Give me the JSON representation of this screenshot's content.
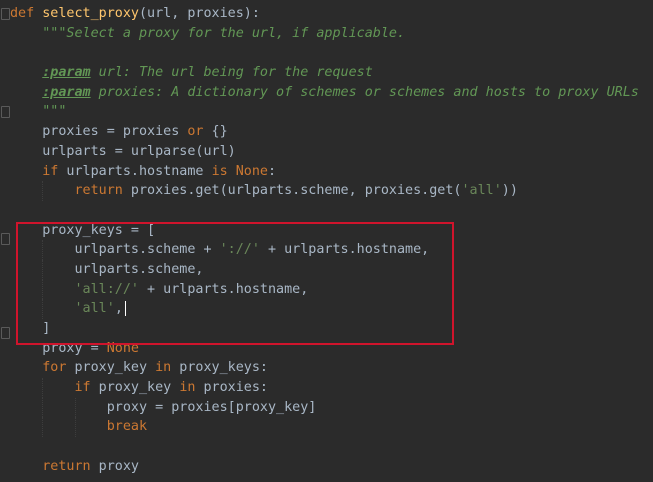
{
  "code": {
    "lines": [
      [
        {
          "t": "def ",
          "c": "kw"
        },
        {
          "t": "select_proxy",
          "c": "fn"
        },
        {
          "t": "(url, proxies):",
          "c": ""
        }
      ],
      [
        {
          "t": "    \"\"\"Select a proxy for the url, if applicable.",
          "c": "doc"
        }
      ],
      [
        {
          "t": "",
          "c": ""
        }
      ],
      [
        {
          "t": "    ",
          "c": ""
        },
        {
          "t": ":param",
          "c": "tag"
        },
        {
          "t": " url: The url being for the request",
          "c": "doc"
        }
      ],
      [
        {
          "t": "    ",
          "c": ""
        },
        {
          "t": ":param",
          "c": "tag"
        },
        {
          "t": " proxies: A dictionary of schemes or schemes and hosts to proxy URLs",
          "c": "doc"
        }
      ],
      [
        {
          "t": "    \"\"\"",
          "c": "doc"
        }
      ],
      [
        {
          "t": "    proxies = proxies ",
          "c": ""
        },
        {
          "t": "or",
          "c": "kw"
        },
        {
          "t": " {}",
          "c": ""
        }
      ],
      [
        {
          "t": "    urlparts = urlparse(url)",
          "c": ""
        }
      ],
      [
        {
          "t": "    ",
          "c": ""
        },
        {
          "t": "if",
          "c": "kw"
        },
        {
          "t": " urlparts.hostname ",
          "c": ""
        },
        {
          "t": "is None",
          "c": "kw"
        },
        {
          "t": ":",
          "c": ""
        }
      ],
      [
        {
          "t": "        ",
          "c": ""
        },
        {
          "t": "return",
          "c": "kw"
        },
        {
          "t": " proxies.get(urlparts.scheme, proxies.get(",
          "c": ""
        },
        {
          "t": "'all'",
          "c": "str"
        },
        {
          "t": "))",
          "c": ""
        }
      ],
      [
        {
          "t": "",
          "c": ""
        }
      ],
      [
        {
          "t": "    proxy_keys = [",
          "c": ""
        }
      ],
      [
        {
          "t": "        urlparts.scheme + ",
          "c": ""
        },
        {
          "t": "'://'",
          "c": "str"
        },
        {
          "t": " + urlparts.hostname,",
          "c": ""
        }
      ],
      [
        {
          "t": "        urlparts.scheme,",
          "c": ""
        }
      ],
      [
        {
          "t": "        ",
          "c": ""
        },
        {
          "t": "'all://'",
          "c": "str"
        },
        {
          "t": " + urlparts.hostname,",
          "c": ""
        }
      ],
      [
        {
          "t": "        ",
          "c": ""
        },
        {
          "t": "'all'",
          "c": "str"
        },
        {
          "t": ",",
          "c": ""
        },
        {
          "t": "",
          "c": "caret"
        }
      ],
      [
        {
          "t": "    ]",
          "c": ""
        }
      ],
      [
        {
          "t": "    proxy = ",
          "c": ""
        },
        {
          "t": "None",
          "c": "kw"
        }
      ],
      [
        {
          "t": "    ",
          "c": ""
        },
        {
          "t": "for",
          "c": "kw"
        },
        {
          "t": " proxy_key ",
          "c": ""
        },
        {
          "t": "in",
          "c": "kw"
        },
        {
          "t": " proxy_keys:",
          "c": ""
        }
      ],
      [
        {
          "t": "        ",
          "c": ""
        },
        {
          "t": "if",
          "c": "kw"
        },
        {
          "t": " proxy_key ",
          "c": ""
        },
        {
          "t": "in",
          "c": "kw"
        },
        {
          "t": " proxies:",
          "c": ""
        }
      ],
      [
        {
          "t": "            proxy = proxies[proxy_key]",
          "c": ""
        }
      ],
      [
        {
          "t": "            ",
          "c": ""
        },
        {
          "t": "break",
          "c": "kw"
        }
      ],
      [
        {
          "t": "",
          "c": ""
        }
      ],
      [
        {
          "t": "    ",
          "c": ""
        },
        {
          "t": "return",
          "c": "kw"
        },
        {
          "t": " proxy",
          "c": ""
        }
      ]
    ]
  },
  "colors": {
    "background": "#2b2b2b",
    "keyword": "#cc7832",
    "function": "#ffc66d",
    "string": "#6a8759",
    "docstring": "#629755",
    "default": "#a9b7c6",
    "highlight_box": "#d0142c"
  }
}
